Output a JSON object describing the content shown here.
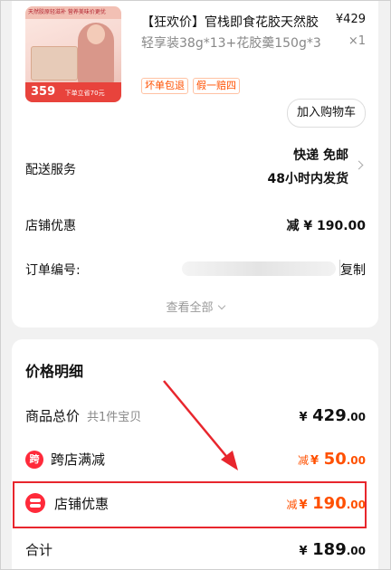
{
  "product": {
    "title_main": "【狂欢价】官栈即食花胶天然胶",
    "title_sub": "轻享装38g*13+花胶羹150g*3",
    "price": "¥429",
    "qty": "×1",
    "tags": [
      "坏单包退",
      "假一赔四"
    ],
    "add_to_cart": "加入购物车",
    "image_text": {
      "brand": "官栈",
      "banner": "天然胶原轻滋补 营养美味价更优",
      "price": "359",
      "promo": "下单立省70元"
    }
  },
  "delivery": {
    "label": "配送服务",
    "line1": "快递 免邮",
    "line2": "48小时内发货"
  },
  "store_discount": {
    "label": "店铺优惠",
    "value": "减 ¥ 190.00"
  },
  "order": {
    "label": "订单编号:",
    "copy": "复制"
  },
  "view_all": "查看全部",
  "price_details": {
    "title": "价格明细",
    "total_goods": {
      "label": "商品总价",
      "sub": "共1件宝贝",
      "cur": "¥",
      "int": "429",
      "dec": ".00"
    },
    "cross_store": {
      "icon": "跨",
      "label": "跨店满减",
      "pre": "减",
      "cur": "¥",
      "int": "50",
      "dec": ".00"
    },
    "store": {
      "label": "店铺优惠",
      "pre": "减",
      "cur": "¥",
      "int": "190",
      "dec": ".00"
    },
    "sum": {
      "label": "合计",
      "cur": "¥",
      "int": "189",
      "dec": ".00"
    }
  },
  "colors": {
    "accent": "#ff5000",
    "highlight_box": "#e8262d",
    "icon_red": "#ff2a3a"
  }
}
